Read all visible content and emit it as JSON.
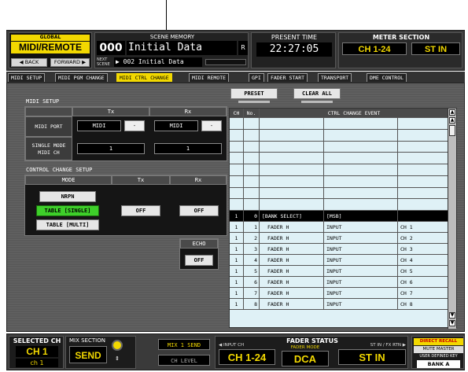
{
  "global": {
    "chip": "GLOBAL",
    "screen": "MIDI/REMOTE",
    "back": "◀ BACK",
    "forward": "FORWARD ▶"
  },
  "scene": {
    "label": "SCENE MEMORY",
    "number": "000",
    "title": "Initial Data",
    "r_flag": "R",
    "next_label": "NEXT\nSCENE",
    "next_value": "▶ 002 Initial Data"
  },
  "time": {
    "label": "PRESENT TIME",
    "value": "22:27:05"
  },
  "meter": {
    "label": "METER SECTION",
    "ch": "CH 1-24",
    "st": "ST IN"
  },
  "tabs": [
    "MIDI SETUP",
    "MIDI PGM CHANGE",
    "MIDI CTRL CHANGE",
    "MIDI REMOTE",
    "GPI",
    "FADER START",
    "TRANSPORT",
    "DME CONTROL"
  ],
  "midi_setup": {
    "title": "MIDI SETUP",
    "tx": "Tx",
    "rx": "Rx",
    "port_label": "MIDI PORT",
    "tx_port": "MIDI",
    "tx_port_num": "-",
    "rx_port": "MIDI",
    "rx_port_num": "-",
    "single_label": "SINGLE MODE\nMIDI CH",
    "tx_ch": "1",
    "rx_ch": "1"
  },
  "cc_setup": {
    "title": "CONTROL CHANGE SETUP",
    "mode": "MODE",
    "tx": "Tx",
    "rx": "Rx",
    "nrpn": "NRPN",
    "table_single": "TABLE [SINGLE]",
    "table_multi": "TABLE [MULTI]",
    "tx_value": "OFF",
    "rx_value": "OFF",
    "echo": "ECHO",
    "echo_value": "OFF"
  },
  "buttons": {
    "preset": "PRESET",
    "clear_all": "CLEAR ALL"
  },
  "event_table": {
    "headers": {
      "ch": "CH",
      "no": "No.",
      "event": "CTRL CHANGE EVENT"
    },
    "rows": [
      {
        "ch": "1",
        "no": "0",
        "a": "[BANK SELECT]",
        "b": "[MSB]",
        "c": ""
      },
      {
        "ch": "1",
        "no": "1",
        "a": "FADER H",
        "b": "INPUT",
        "c": "CH 1"
      },
      {
        "ch": "1",
        "no": "2",
        "a": "FADER H",
        "b": "INPUT",
        "c": "CH 2"
      },
      {
        "ch": "1",
        "no": "3",
        "a": "FADER H",
        "b": "INPUT",
        "c": "CH 3"
      },
      {
        "ch": "1",
        "no": "4",
        "a": "FADER H",
        "b": "INPUT",
        "c": "CH 4"
      },
      {
        "ch": "1",
        "no": "5",
        "a": "FADER H",
        "b": "INPUT",
        "c": "CH 5"
      },
      {
        "ch": "1",
        "no": "6",
        "a": "FADER H",
        "b": "INPUT",
        "c": "CH 6"
      },
      {
        "ch": "1",
        "no": "7",
        "a": "FADER H",
        "b": "INPUT",
        "c": "CH 7"
      },
      {
        "ch": "1",
        "no": "8",
        "a": "FADER H",
        "b": "INPUT",
        "c": "CH 8"
      }
    ]
  },
  "bottom": {
    "selected_label": "SELECTED CH",
    "selected_ch": "CH 1",
    "selected_sub": "ch 1",
    "mix_label": "MIX SECTION",
    "mix_value": "SEND",
    "mix1_send": "MIX 1 SEND",
    "ch_level": "CH LEVEL",
    "fader_status": "FADER STATUS",
    "input_ch": "◀ INPUT CH",
    "input_ch_value": "CH 1-24",
    "st_label": "ST IN / FX RTN ▶",
    "st_value": "ST IN",
    "fader_mode": "FADER MODE",
    "fader_mode_value": "DCA",
    "direct_recall": "DIRECT RECALL",
    "mute_master": "MUTE MASTER",
    "user_key": "USER DEFINED KEY",
    "bank": "BANK A"
  }
}
